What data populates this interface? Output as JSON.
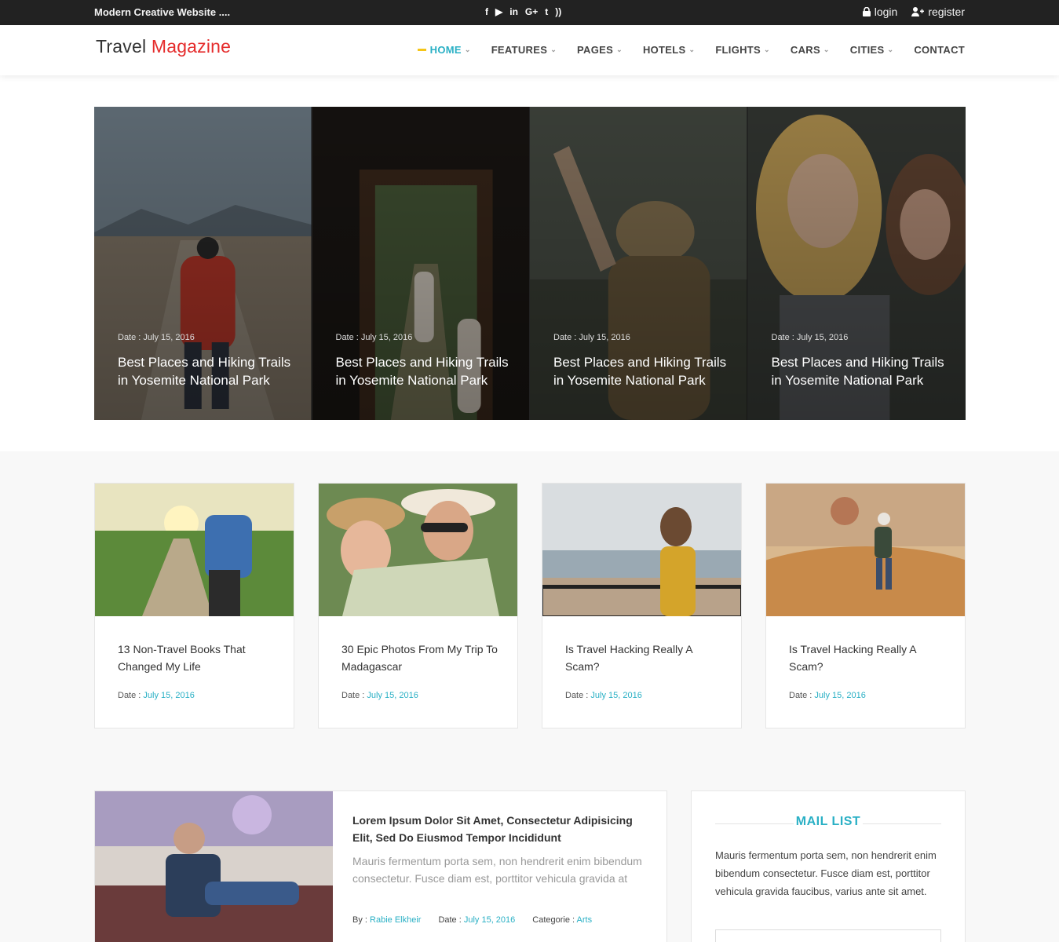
{
  "topbar": {
    "tagline": "Modern Creative Website ....",
    "socials": [
      {
        "icon": "facebook-icon",
        "glyph": "f"
      },
      {
        "icon": "youtube-icon",
        "glyph": "▶"
      },
      {
        "icon": "linkedin-icon",
        "glyph": "in"
      },
      {
        "icon": "google-plus-icon",
        "glyph": "G+"
      },
      {
        "icon": "twitter-icon",
        "glyph": "t"
      },
      {
        "icon": "rss-icon",
        "glyph": "))"
      }
    ],
    "login_label": "login",
    "register_label": "register"
  },
  "header": {
    "logo_main": "Travel",
    "logo_accent": "Magazine",
    "nav": [
      {
        "label": "HOME",
        "active": true,
        "dropdown": true
      },
      {
        "label": "FEATURES",
        "active": false,
        "dropdown": true
      },
      {
        "label": "PAGES",
        "active": false,
        "dropdown": true
      },
      {
        "label": "HOTELS",
        "active": false,
        "dropdown": true
      },
      {
        "label": "FLIGHTS",
        "active": false,
        "dropdown": true
      },
      {
        "label": "CARS",
        "active": false,
        "dropdown": true
      },
      {
        "label": "CITIES",
        "active": false,
        "dropdown": true
      },
      {
        "label": "CONTACT",
        "active": false,
        "dropdown": false
      }
    ]
  },
  "hero": {
    "cards": [
      {
        "date": "Date : July 15, 2016",
        "title": "Best Places and Hiking Trails in Yosemite National Park"
      },
      {
        "date": "Date : July 15, 2016",
        "title": "Best Places and Hiking Trails in Yosemite National Park"
      },
      {
        "date": "Date : July 15, 2016",
        "title": "Best Places and Hiking Trails in Yosemite National Park"
      },
      {
        "date": "Date : July 15, 2016",
        "title": "Best Places and Hiking Trails in Yosemite National Park"
      }
    ]
  },
  "posts": [
    {
      "title": "13 Non-Travel Books That Changed My Life",
      "date_label": "Date : ",
      "date_value": "July 15, 2016"
    },
    {
      "title": "30 Epic Photos From My Trip To Madagascar",
      "date_label": "Date : ",
      "date_value": "July 15, 2016"
    },
    {
      "title": "Is Travel Hacking Really A Scam?",
      "date_label": "Date : ",
      "date_value": "July 15, 2016"
    },
    {
      "title": "Is Travel Hacking Really A Scam?",
      "date_label": "Date : ",
      "date_value": "July 15, 2016"
    }
  ],
  "feature": {
    "title": "Lorem Ipsum Dolor Sit Amet, Consectetur Adipisicing Elit, Sed Do Eiusmod Tempor Incididunt",
    "excerpt": "Mauris fermentum porta sem, non hendrerit enim bibendum consectetur. Fusce diam est, porttitor vehicula gravida at",
    "by_label": "By : ",
    "by_value": "Rabie Elkheir",
    "date_label": "Date : ",
    "date_value": "July 15, 2016",
    "category_label": "Categorie : ",
    "category_value": "Arts"
  },
  "mail": {
    "title": "MAIL LIST",
    "text": "Mauris fermentum porta sem, non hendrerit enim bibendum consectetur. Fusce diam est, porttitor vehicula gravida faucibus, varius ante sit amet."
  },
  "colors": {
    "accent": "#2ab0c5",
    "brand_red": "#e52b2b",
    "active_bar": "#f5c518",
    "topbar": "#222222"
  }
}
